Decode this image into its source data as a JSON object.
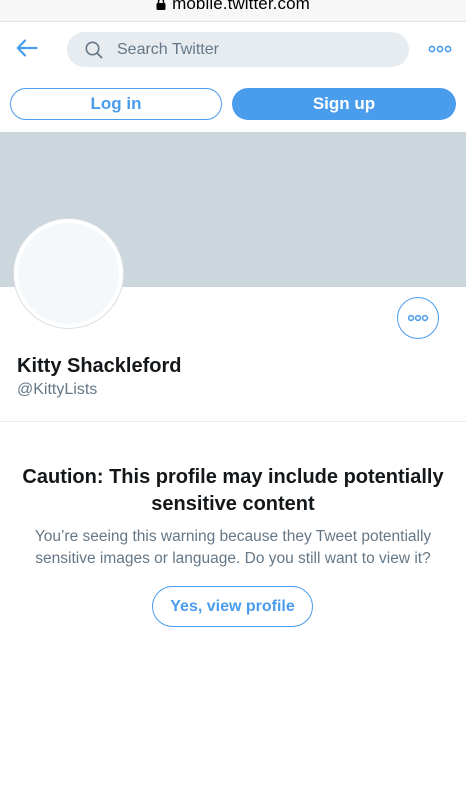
{
  "browser": {
    "url": "mobile.twitter.com",
    "lock_icon": "lock-icon"
  },
  "header": {
    "back_icon": "arrow-left-icon",
    "search_icon": "search-icon",
    "search_placeholder": "Search Twitter",
    "search_value": "",
    "more_icon": "more-dots-icon"
  },
  "auth": {
    "login_label": "Log in",
    "signup_label": "Sign up"
  },
  "profile": {
    "display_name": "Kitty Shackleford",
    "screen_name": "@KittyLists",
    "more_icon": "more-dots-icon"
  },
  "warning": {
    "title": "Caution: This profile may include potentially sensitive content",
    "body": "You’re seeing this warning because they Tweet potentially sensitive images or language. Do you still want to view it?",
    "button_label": "Yes, view profile"
  },
  "colors": {
    "accent": "#4a9ced",
    "banner": "#ccd6dd",
    "search_bg": "#e6ecf0",
    "secondary_text": "#657786",
    "primary_text": "#14171a"
  }
}
